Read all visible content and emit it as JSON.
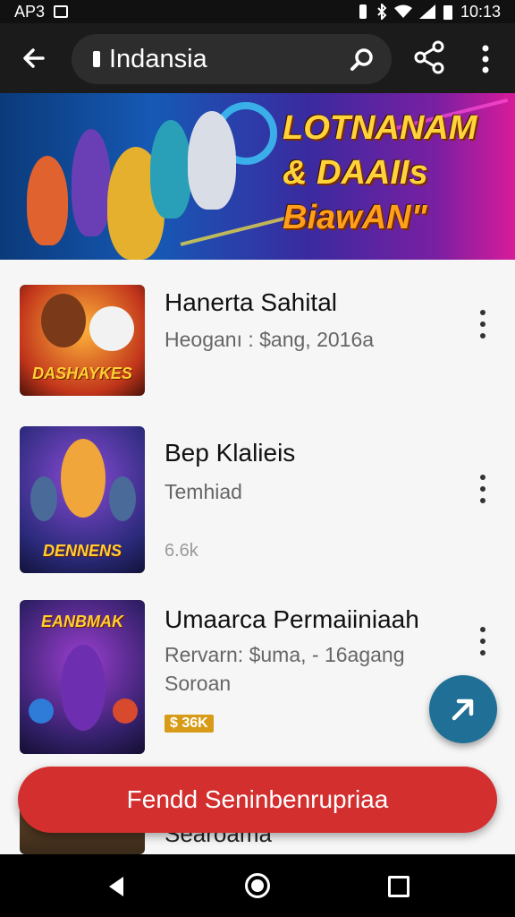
{
  "status_bar": {
    "left_text": "AP3",
    "time": "10:13"
  },
  "app_bar": {
    "search_text": "Indansia",
    "icons": [
      "back-arrow-icon",
      "search-icon",
      "share-icon",
      "more-vert-icon"
    ]
  },
  "banner": {
    "line1": "LOTNANAM",
    "line2": "& DAAIIs",
    "line3": "BiawAN\""
  },
  "list": {
    "items": [
      {
        "thumb_caption": "DASHAYKES",
        "title": "Hanerta Sahital",
        "subtitle": "Heoganı : $ang, 2016a",
        "meta": "",
        "badge": ""
      },
      {
        "thumb_caption": "DENNENS",
        "title": "Bep Klalieis",
        "subtitle": "Temhiad",
        "meta": "6.6k",
        "badge": ""
      },
      {
        "thumb_caption": "EANBMAK",
        "title": "Umaarca Permaiiniaah",
        "subtitle": "Rervarn: $uma, - 16agang",
        "meta": "Soroan",
        "badge": "$ 36K"
      }
    ],
    "partial_title": "Searoama"
  },
  "fab": {
    "icon": "arrow-up-right-icon"
  },
  "cta": {
    "label": "Fendd Seninbenrupriaa"
  },
  "nav_bar": {
    "icons": [
      "nav-back-icon",
      "nav-home-icon",
      "nav-recents-icon"
    ]
  },
  "colors": {
    "app_bar": "#1b1b1b",
    "cta": "#d32f2f",
    "fab": "#1f6f96",
    "badge": "#d89b18"
  }
}
